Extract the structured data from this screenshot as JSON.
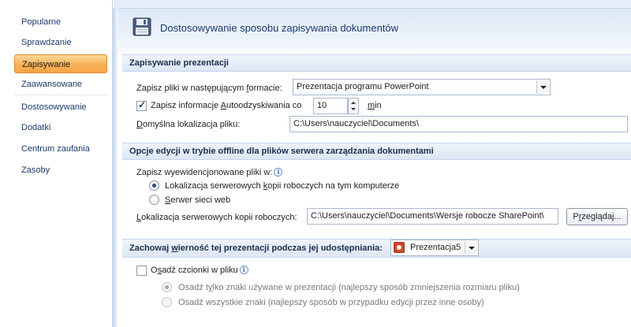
{
  "sidebar": {
    "items": [
      {
        "label": "Popularne"
      },
      {
        "label": "Sprawdzanie"
      },
      {
        "label": "Zapisywanie"
      },
      {
        "label": "Zaawansowane"
      },
      {
        "label": "Dostosowywanie"
      },
      {
        "label": "Dodatki"
      },
      {
        "label": "Centrum zaufania"
      },
      {
        "label": "Zasoby"
      }
    ],
    "active_index": 2
  },
  "header": {
    "title": "Dostosowywanie sposobu zapisywania dokumentów",
    "icon": "floppy-disk-icon"
  },
  "section_save": {
    "title": "Zapisywanie prezentacji",
    "format_label_pre": "Zapisz pliki w następującym ",
    "format_label_u": "f",
    "format_label_post": "ormacie:",
    "format_value": "Prezentacja programu PowerPoint",
    "autorecover_checked": true,
    "autorecover_label_pre": "Zapisz informacje ",
    "autorecover_label_u": "A",
    "autorecover_label_post": "utoodzyskiwania co",
    "autorecover_minutes": "10",
    "autorecover_unit_u": "m",
    "autorecover_unit_post": "in",
    "default_location_label_u": "D",
    "default_location_label_post": "omyślna lokalizacja pliku:",
    "default_location_value": "C:\\Users\\nauczyciel\\Documents\\"
  },
  "section_offline": {
    "title": "Opcje edycji w trybie offline dla plików serwera zarządzania dokumentami",
    "checked_out_label": "Zapisz wyewidencjonowane pliki w:",
    "option1_pre": "Lokalizacja serwerowych ",
    "option1_u": "k",
    "option1_post": "opii roboczych na tym komputerze",
    "option1_selected": true,
    "option2_u": "S",
    "option2_post": "erwer sieci web",
    "option2_selected": false,
    "drafts_label_u": "L",
    "drafts_label_post": "okalizacja serwerowych kopii roboczych:",
    "drafts_value": "C:\\Users\\nauczyciel\\Documents\\Wersje robocze SharePoint\\",
    "browse_pre": "P",
    "browse_u": "r",
    "browse_post": "zeglądaj..."
  },
  "section_fidelity": {
    "title_pre": "Zachowaj ",
    "title_u": "w",
    "title_post": "ierność tej prezentacji podczas jej udostępniania:",
    "presentation_value": "Prezentacja5",
    "embed_checked": false,
    "embed_label_pre": "O",
    "embed_label_u": "s",
    "embed_label_post": "adź czcionki w pliku",
    "embed_opt1_pre": "Osadź t",
    "embed_opt1_u": "y",
    "embed_opt1_post": "lko znaki używane w prezentacji (najlepszy sposób zmniejszenia rozmiaru pliku)",
    "embed_opt1_selected": true,
    "embed_opt2_pre": "Osadź wszystkie znaki (najlepszy sposób w przypadku edycji przez inne osoby)",
    "embed_opt2_selected": false
  },
  "colors": {
    "active_item": "#f9b25a",
    "section_header_bg": "#dde7f4",
    "accent_text": "#1a3a6b"
  }
}
